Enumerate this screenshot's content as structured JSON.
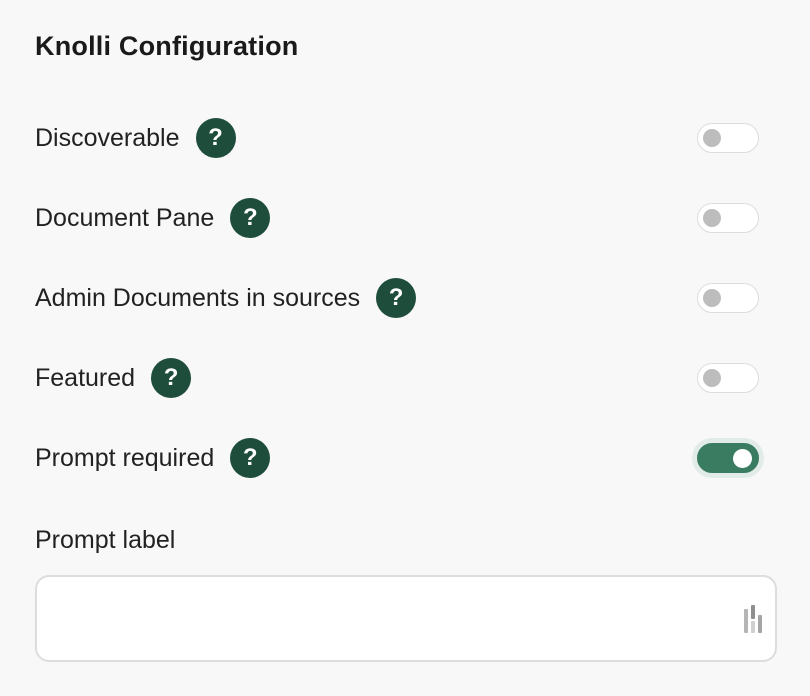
{
  "panel": {
    "title": "Knolli Configuration"
  },
  "settings": [
    {
      "label": "Discoverable",
      "help_icon": "question-mark-icon",
      "help_glyph": "?",
      "enabled": false
    },
    {
      "label": "Document Pane",
      "help_icon": "question-mark-icon",
      "help_glyph": "?",
      "enabled": false
    },
    {
      "label": "Admin Documents in sources",
      "help_icon": "question-mark-icon",
      "help_glyph": "?",
      "enabled": false
    },
    {
      "label": "Featured",
      "help_icon": "question-mark-icon",
      "help_glyph": "?",
      "enabled": false
    },
    {
      "label": "Prompt required",
      "help_icon": "question-mark-icon",
      "help_glyph": "?",
      "enabled": true
    }
  ],
  "prompt_label": {
    "label": "Prompt label",
    "value": "",
    "placeholder": "",
    "trailing_icon": "grip-icon"
  },
  "colors": {
    "background": "#f8f8f8",
    "help_icon_bg": "#1e4d3c",
    "toggle_on": "#3a7c61",
    "toggle_off_knob": "#bdbdbd"
  }
}
